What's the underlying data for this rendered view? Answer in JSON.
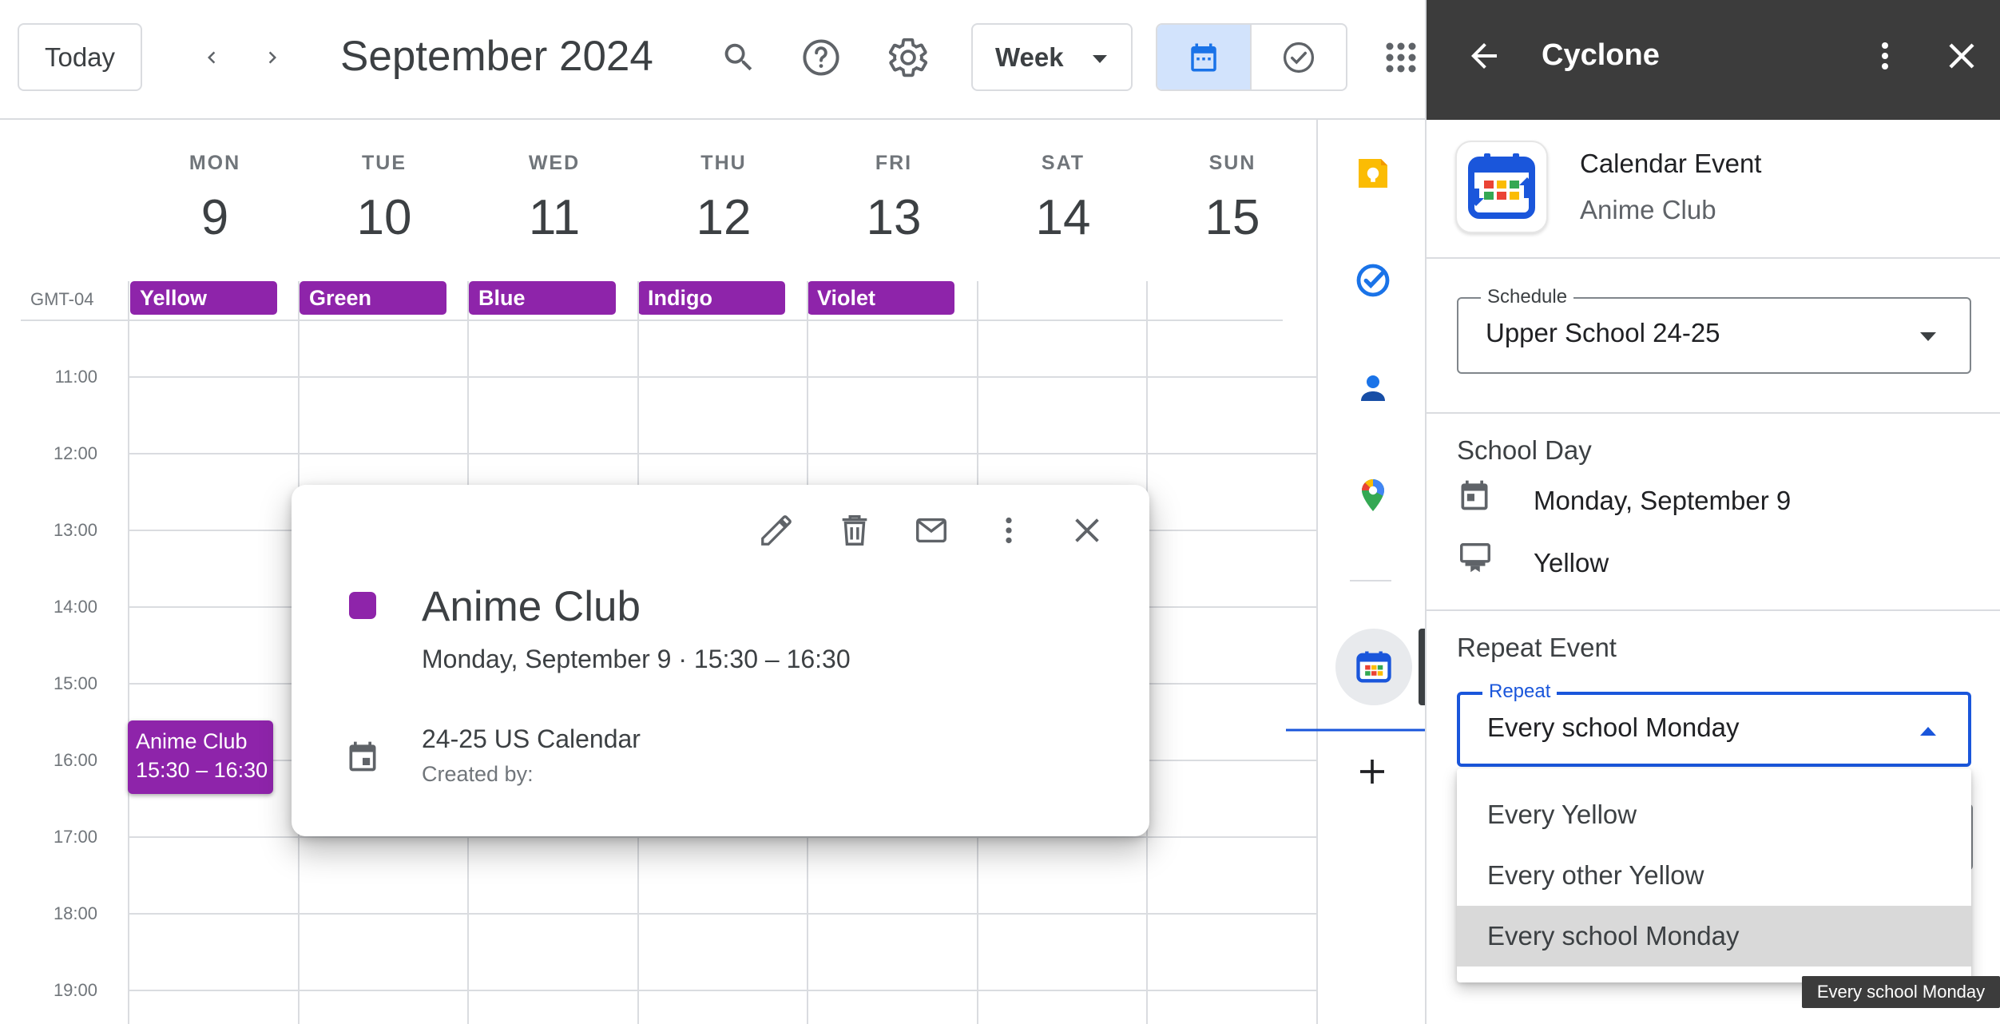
{
  "topbar": {
    "today_label": "Today",
    "month_title": "September 2024",
    "view_select": "Week",
    "icons": [
      "chevron-left-icon",
      "chevron-right-icon",
      "search-icon",
      "help-icon",
      "gear-icon",
      "calendar-view-icon",
      "tasks-view-icon",
      "apps-grid-icon"
    ]
  },
  "calendar": {
    "timezone": "GMT-04",
    "days": [
      {
        "name": "MON",
        "date": "9"
      },
      {
        "name": "TUE",
        "date": "10"
      },
      {
        "name": "WED",
        "date": "11"
      },
      {
        "name": "THU",
        "date": "12"
      },
      {
        "name": "FRI",
        "date": "13"
      },
      {
        "name": "SAT",
        "date": "14"
      },
      {
        "name": "SUN",
        "date": "15"
      }
    ],
    "all_day_chips": [
      "Yellow",
      "Green",
      "Blue",
      "Indigo",
      "Violet"
    ],
    "hours": [
      "11:00",
      "12:00",
      "13:00",
      "14:00",
      "15:00",
      "16:00",
      "17:00",
      "18:00",
      "19:00"
    ],
    "event": {
      "title": "Anime Club",
      "time": "15:30 – 16:30",
      "color": "#8e24aa"
    }
  },
  "popover": {
    "title": "Anime Club",
    "when": "Monday, September 9  ·  15:30 – 16:30",
    "calendar_name": "24-25 US Calendar",
    "created_by": "Created by:",
    "color": "#8e24aa"
  },
  "rail": {
    "icons": [
      "keep-icon",
      "tasks-icon",
      "contacts-icon",
      "maps-icon",
      "cyclone-addon-icon",
      "add-icon"
    ]
  },
  "panel": {
    "title": "Cyclone",
    "app_label": "Calendar Event",
    "event_name": "Anime Club",
    "schedule": {
      "label": "Schedule",
      "value": "Upper School 24-25"
    },
    "school_day": {
      "title": "School Day",
      "date": "Monday, September 9",
      "day_type": "Yellow"
    },
    "repeat_event": {
      "title": "Repeat Event",
      "label": "Repeat",
      "value": "Every school Monday",
      "options": [
        "Every Yellow",
        "Every other Yellow",
        "Every school Monday"
      ],
      "selected_index": 2
    },
    "tooltip": "Every school Monday",
    "accent": "#1a56db",
    "header_bg": "#3c3c3c"
  }
}
